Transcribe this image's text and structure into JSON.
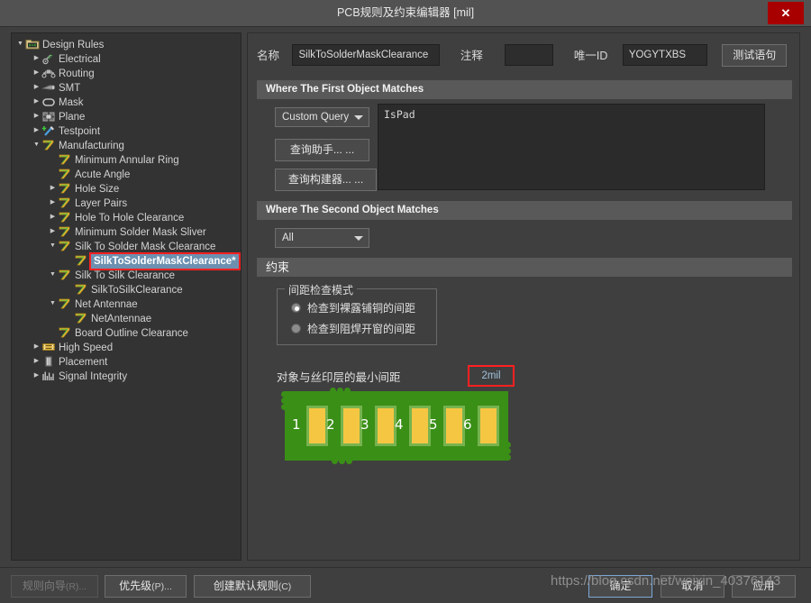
{
  "window": {
    "title": "PCB规则及约束编辑器 [mil]",
    "close_label": "✕"
  },
  "tree": {
    "items": [
      {
        "label": "Design Rules",
        "depth": 0,
        "arrow": "down",
        "icon": "folder-rules-icon",
        "selected": false
      },
      {
        "label": "Electrical",
        "depth": 1,
        "arrow": "right",
        "icon": "electrical-icon",
        "selected": false
      },
      {
        "label": "Routing",
        "depth": 1,
        "arrow": "right",
        "icon": "routing-icon",
        "selected": false
      },
      {
        "label": "SMT",
        "depth": 1,
        "arrow": "right",
        "icon": "smt-icon",
        "selected": false
      },
      {
        "label": "Mask",
        "depth": 1,
        "arrow": "right",
        "icon": "mask-icon",
        "selected": false
      },
      {
        "label": "Plane",
        "depth": 1,
        "arrow": "right",
        "icon": "plane-icon",
        "selected": false
      },
      {
        "label": "Testpoint",
        "depth": 1,
        "arrow": "right",
        "icon": "testpoint-icon",
        "selected": false
      },
      {
        "label": "Manufacturing",
        "depth": 1,
        "arrow": "down",
        "icon": "manufacturing-icon",
        "selected": false
      },
      {
        "label": "Minimum Annular Ring",
        "depth": 2,
        "arrow": "none",
        "icon": "rule-icon",
        "selected": false
      },
      {
        "label": "Acute Angle",
        "depth": 2,
        "arrow": "none",
        "icon": "rule-icon",
        "selected": false
      },
      {
        "label": "Hole Size",
        "depth": 2,
        "arrow": "right",
        "icon": "rule-icon",
        "selected": false
      },
      {
        "label": "Layer Pairs",
        "depth": 2,
        "arrow": "right",
        "icon": "rule-icon",
        "selected": false
      },
      {
        "label": "Hole To Hole Clearance",
        "depth": 2,
        "arrow": "right",
        "icon": "rule-icon",
        "selected": false
      },
      {
        "label": "Minimum Solder Mask Sliver",
        "depth": 2,
        "arrow": "right",
        "icon": "rule-icon",
        "selected": false
      },
      {
        "label": "Silk To Solder Mask Clearance",
        "depth": 2,
        "arrow": "down",
        "icon": "rule-icon",
        "selected": false
      },
      {
        "label": "SilkToSolderMaskClearance*",
        "depth": 3,
        "arrow": "none",
        "icon": "rule-icon",
        "selected": true
      },
      {
        "label": "Silk To Silk Clearance",
        "depth": 2,
        "arrow": "down",
        "icon": "rule-icon",
        "selected": false
      },
      {
        "label": "SilkToSilkClearance",
        "depth": 3,
        "arrow": "none",
        "icon": "rule-icon",
        "selected": false
      },
      {
        "label": "Net Antennae",
        "depth": 2,
        "arrow": "down",
        "icon": "rule-icon",
        "selected": false
      },
      {
        "label": "NetAntennae",
        "depth": 3,
        "arrow": "none",
        "icon": "rule-icon",
        "selected": false
      },
      {
        "label": "Board Outline Clearance",
        "depth": 2,
        "arrow": "none",
        "icon": "rule-icon",
        "selected": false
      },
      {
        "label": "High Speed",
        "depth": 1,
        "arrow": "right",
        "icon": "highspeed-icon",
        "selected": false
      },
      {
        "label": "Placement",
        "depth": 1,
        "arrow": "right",
        "icon": "placement-icon",
        "selected": false
      },
      {
        "label": "Signal Integrity",
        "depth": 1,
        "arrow": "right",
        "icon": "signal-integrity-icon",
        "selected": false
      }
    ]
  },
  "detail": {
    "name_label": "名称",
    "name_value": "SilkToSolderMaskClearance",
    "comment_label": "注释",
    "comment_value": "",
    "uid_label": "唯一ID",
    "uid_value": "YOGYTXBS",
    "test_query_button": "测试语句",
    "first_object_section": "Where The First Object Matches",
    "first_object_scope": "Custom Query",
    "query_helper_button": "查询助手... ...",
    "query_builder_button": "查询构建器... ...",
    "query_text": "IsPad",
    "second_object_section": "Where The Second Object Matches",
    "second_object_scope": "All",
    "constraints_section": "约束",
    "clearance_mode_group": "间距检查模式",
    "radio_bare_copper": "检查到裸露铺铜的间距",
    "radio_solder_mask_opening": "检查到阻焊开窗的间距",
    "radio_selected_index": 0,
    "min_clearance_label": "对象与丝印层的最小间距",
    "min_clearance_value": "2mil"
  },
  "pcb_preview": {
    "pad_numbers": [
      "1",
      "2",
      "3",
      "4",
      "5",
      "6"
    ],
    "board_color": "#3a8f16",
    "pad_color": "#f5c642",
    "pad_outline_color": "#77b34f"
  },
  "footer": {
    "rule_wizard_button": "规则向导",
    "rule_wizard_mnemonic": "(R)...",
    "priority_button": "优先级",
    "priority_mnemonic": "(P)...",
    "create_default_rules_button": "创建默认规则",
    "create_default_rules_mnemonic": "(C)",
    "ok_button": "确定",
    "cancel_button": "取消",
    "apply_button": "应用"
  },
  "watermark": {
    "text": "https://blog.csdn.net/weixin_40376143"
  }
}
